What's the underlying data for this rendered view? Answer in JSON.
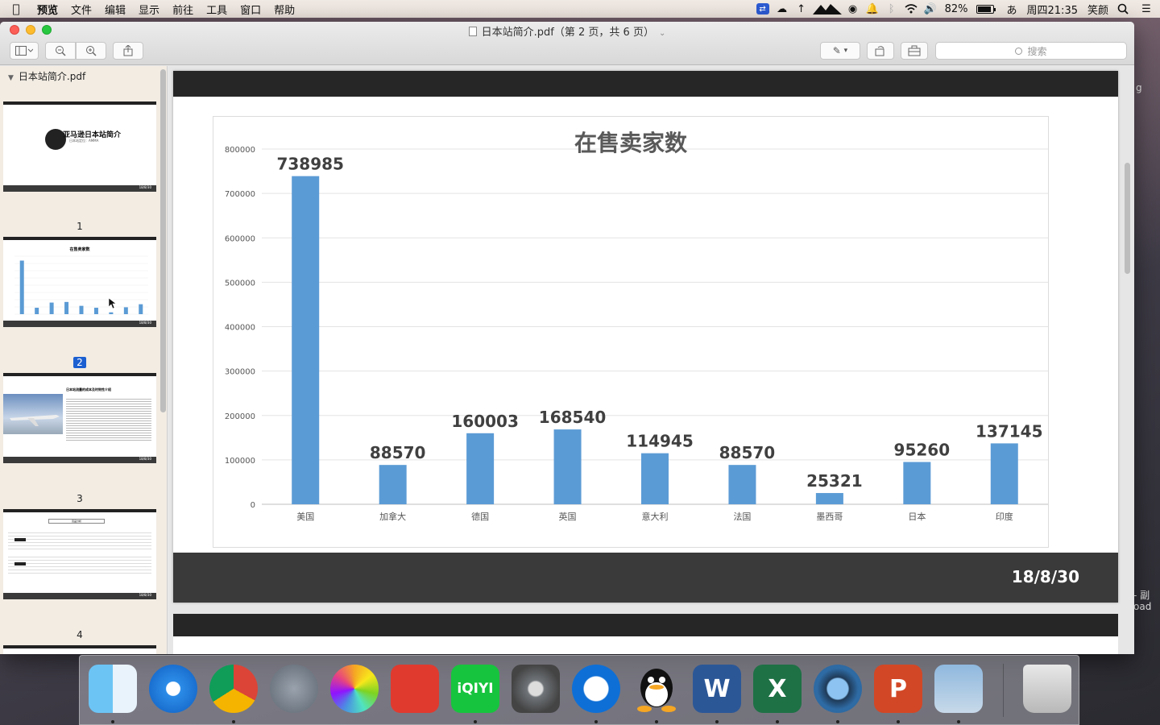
{
  "menubar": {
    "app_name": "预览",
    "items": [
      "文件",
      "编辑",
      "显示",
      "前往",
      "工具",
      "窗口",
      "帮助"
    ],
    "battery": "82%",
    "clock": "周四21:35",
    "user": "笑颜",
    "input_method": "あ"
  },
  "window": {
    "title": "日本站简介.pdf（第 2 页，共 6 页）",
    "search_placeholder": "搜索"
  },
  "sidebar": {
    "file_name": "日本站简介.pdf",
    "thumbnails": [
      {
        "page": "1",
        "title": "亚马逊日本站简介",
        "subtitle": "日本站定位：AMMA",
        "footer": "18/8/30"
      },
      {
        "page": "2",
        "title": "在售卖家数",
        "footer": "18/8/30",
        "selected": true
      },
      {
        "page": "3",
        "title": "日本站流量的成本及时效性介绍",
        "footer": "18/8/30"
      },
      {
        "page": "4",
        "title": "竞品分析",
        "footer": "18/8/30"
      }
    ]
  },
  "page": {
    "date": "18/8/30"
  },
  "chart_data": {
    "type": "bar",
    "title": "在售卖家数",
    "categories": [
      "美国",
      "加拿大",
      "德国",
      "英国",
      "意大利",
      "法国",
      "墨西哥",
      "日本",
      "印度"
    ],
    "values": [
      738985,
      88570,
      160003,
      168540,
      114945,
      88570,
      25321,
      95260,
      137145
    ],
    "data_labels": [
      "738985",
      "88570",
      "160003",
      "168540",
      "114945",
      "88570",
      "25321",
      "95260",
      "137145"
    ],
    "ylim": [
      0,
      800000
    ],
    "yticks": [
      "0",
      "100000",
      "200000",
      "300000",
      "400000",
      "500000",
      "600000",
      "700000",
      "800000"
    ],
    "grid": true,
    "bar_color": "#5b9bd5",
    "xlabel": "",
    "ylabel": ""
  },
  "dock": {
    "apps": [
      {
        "name": "Finder",
        "icon": "finder-icon",
        "running": true
      },
      {
        "name": "Safari",
        "icon": "safari-icon",
        "running": false
      },
      {
        "name": "Chrome",
        "icon": "chrome-icon",
        "running": true
      },
      {
        "name": "Launchpad",
        "icon": "launchpad-icon",
        "running": false
      },
      {
        "name": "Photos",
        "icon": "photos-icon",
        "running": false
      },
      {
        "name": "Remote Desktop",
        "icon": "remote-desktop-icon",
        "running": false
      },
      {
        "name": "爱奇艺",
        "icon": "iqiyi-icon",
        "label": "iQIYI",
        "running": true
      },
      {
        "name": "System Preferences",
        "icon": "system-preferences-icon",
        "running": false
      },
      {
        "name": "TeamViewer",
        "icon": "teamviewer-icon",
        "running": true
      },
      {
        "name": "QQ",
        "icon": "qq-icon",
        "running": true
      },
      {
        "name": "Word",
        "icon": "word-icon",
        "label": "W",
        "running": true
      },
      {
        "name": "Excel",
        "icon": "excel-icon",
        "label": "X",
        "running": true
      },
      {
        "name": "QuickTime",
        "icon": "quicktime-icon",
        "running": true
      },
      {
        "name": "PowerPoint",
        "icon": "powerpoint-icon",
        "label": "P",
        "running": true
      },
      {
        "name": "Preview",
        "icon": "preview-icon",
        "running": true
      },
      {
        "name": "Trash",
        "icon": "trash-icon",
        "running": false
      }
    ]
  },
  "desktop": {
    "side_text_1": "g",
    "side_text_2": "- 副",
    "side_text_3": "oad"
  }
}
